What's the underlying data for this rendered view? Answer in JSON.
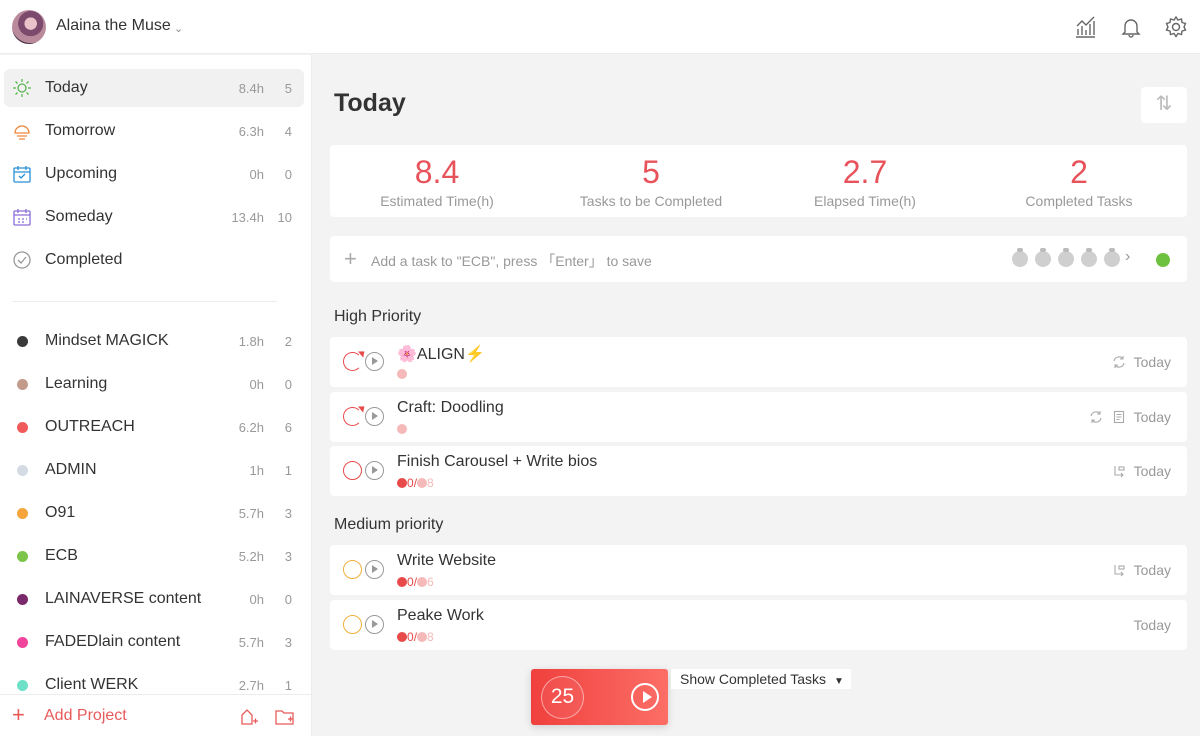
{
  "user": {
    "name": "Alaina the Muse"
  },
  "nav": [
    {
      "label": "Today",
      "time": "8.4h",
      "count": "5",
      "icon": "sun-icon",
      "color": "#5ab552"
    },
    {
      "label": "Tomorrow",
      "time": "6.3h",
      "count": "4",
      "icon": "sunset-icon",
      "color": "#f0863c"
    },
    {
      "label": "Upcoming",
      "time": "0h",
      "count": "0",
      "icon": "calendar-check-icon",
      "color": "#2a8fd8"
    },
    {
      "label": "Someday",
      "time": "13.4h",
      "count": "10",
      "icon": "calendar-icon",
      "color": "#8a6ed8"
    },
    {
      "label": "Completed",
      "time": "",
      "count": "",
      "icon": "check-circle-icon",
      "color": "#999999"
    }
  ],
  "projects": [
    {
      "label": "Mindset MAGICK",
      "time": "1.8h",
      "count": "2",
      "color": "#3a3a3a"
    },
    {
      "label": "Learning",
      "time": "0h",
      "count": "0",
      "color": "#c29b8a"
    },
    {
      "label": "OUTREACH",
      "time": "6.2h",
      "count": "6",
      "color": "#f05a5a"
    },
    {
      "label": "ADMIN",
      "time": "1h",
      "count": "1",
      "color": "#d4dbe2"
    },
    {
      "label": "O91",
      "time": "5.7h",
      "count": "3",
      "color": "#f5a53b"
    },
    {
      "label": "ECB",
      "time": "5.2h",
      "count": "3",
      "color": "#7dc44b"
    },
    {
      "label": "LAINAVERSE content",
      "time": "0h",
      "count": "0",
      "color": "#7a2a6a"
    },
    {
      "label": "FADEDlain content",
      "time": "5.7h",
      "count": "3",
      "color": "#f0459a"
    },
    {
      "label": "Client WERK",
      "time": "2.7h",
      "count": "1",
      "color": "#6fe0c8"
    }
  ],
  "sidebar_footer": {
    "add_project": "Add Project"
  },
  "main": {
    "title": "Today",
    "stats": [
      {
        "value": "8.4",
        "label": "Estimated Time(h)"
      },
      {
        "value": "5",
        "label": "Tasks to be Completed"
      },
      {
        "value": "2.7",
        "label": "Elapsed Time(h)"
      },
      {
        "value": "2",
        "label": "Completed Tasks"
      }
    ],
    "add_task_placeholder": "Add a task to \"ECB\", press 「Enter」 to save",
    "sections": [
      {
        "title": "High Priority",
        "tasks": [
          {
            "title": "🌸ALIGN⚡",
            "done": "",
            "est": "",
            "date": "Today"
          },
          {
            "title": "Craft: Doodling",
            "done": "",
            "est": "",
            "date": "Today"
          },
          {
            "title": "Finish Carousel + Write bios",
            "done": "0",
            "est": "8",
            "date": "Today"
          }
        ]
      },
      {
        "title": "Medium priority",
        "tasks": [
          {
            "title": "Write Website",
            "done": "0",
            "est": "6",
            "date": "Today"
          },
          {
            "title": "Peake Work",
            "done": "0",
            "est": "8",
            "date": "Today"
          }
        ]
      }
    ],
    "timer": {
      "minutes": "25"
    },
    "show_completed": "Show Completed Tasks"
  },
  "colors": {
    "accent": "#e8525a",
    "high_priority": "#e84a4a",
    "medium_priority": "#f0b03c"
  }
}
